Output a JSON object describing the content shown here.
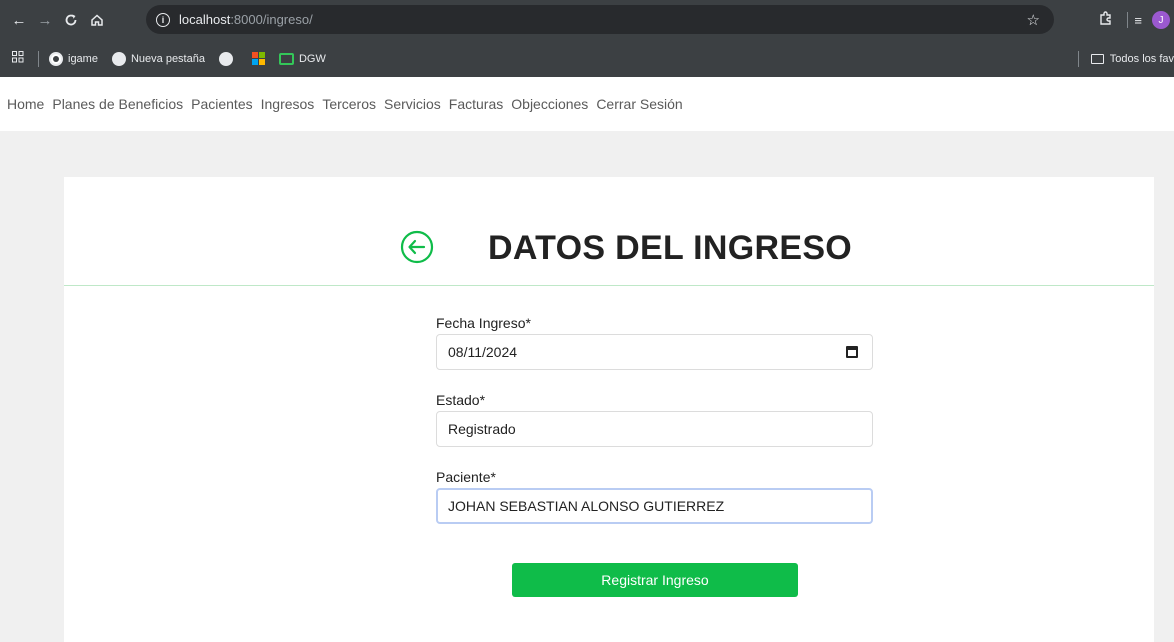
{
  "browser": {
    "url_host": "localhost",
    "url_rest": ":8000/ingreso/",
    "avatar_letter": "J"
  },
  "bookmarks": {
    "items": [
      {
        "label": "igame",
        "icon": "whatsapp-icon"
      },
      {
        "label": "Nueva pestaña",
        "icon": "globe-icon"
      },
      {
        "label": "",
        "icon": "globe-icon"
      },
      {
        "label": "",
        "icon": "microsoft-icon"
      },
      {
        "label": "DGW",
        "icon": "dgw-icon"
      }
    ],
    "all_bookmarks": "Todos los fav"
  },
  "nav": {
    "items": [
      "Home",
      "Planes de Beneficios",
      "Pacientes",
      "Ingresos",
      "Terceros",
      "Servicios",
      "Facturas",
      "Objecciones",
      "Cerrar Sesión"
    ]
  },
  "page": {
    "title": "DATOS DEL INGRESO",
    "accent_color": "#0fbc49"
  },
  "form": {
    "fecha_label": "Fecha Ingreso*",
    "fecha_value": "08/11/2024",
    "estado_label": "Estado*",
    "estado_value": "Registrado",
    "paciente_label": "Paciente*",
    "paciente_value": "JOHAN SEBASTIAN ALONSO GUTIERREZ",
    "submit_label": "Registrar Ingreso"
  }
}
